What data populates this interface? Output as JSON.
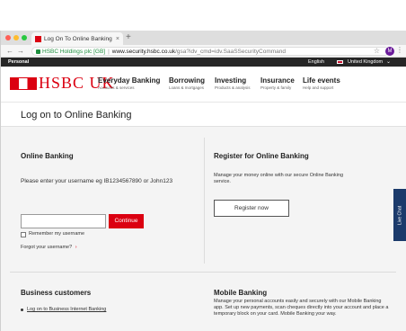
{
  "browser": {
    "tab_title": "Log On To Online Banking",
    "tab_close": "×",
    "new_tab": "+",
    "back": "←",
    "forward": "→",
    "secure_org": "HSBC Holdings plc [GB]",
    "url_host": "www.security.hsbc.co.uk",
    "url_path": "/gsa?idv_cmd=idv.SaaSSecurityCommand",
    "star": "☆",
    "profile_initial": "M",
    "menu": "⋮",
    "traffic_lights": [
      "#ff5f57",
      "#febc2e",
      "#28c840"
    ]
  },
  "topbar": {
    "personal": "Personal",
    "language": "English",
    "country": "United Kingdom"
  },
  "logo": {
    "text": "HSBC UK"
  },
  "nav": [
    {
      "title": "Everyday Banking",
      "subtitle": "Accounts & services"
    },
    {
      "title": "Borrowing",
      "subtitle": "Loans & mortgages"
    },
    {
      "title": "Investing",
      "subtitle": "Products & analysis"
    },
    {
      "title": "Insurance",
      "subtitle": "Property & family"
    },
    {
      "title": "Life events",
      "subtitle": "Help and support"
    }
  ],
  "page_title": "Log on to Online Banking",
  "online_banking": {
    "heading": "Online Banking",
    "instruction": "Please enter your username eg IB1234567890 or John123",
    "continue_label": "Continue",
    "remember_label": "Remember my username",
    "forgot_label": "Forgot your username?",
    "forgot_arrow": "›"
  },
  "register": {
    "heading": "Register for Online Banking",
    "text": "Manage your money online with our secure Online Banking service.",
    "button_label": "Register now"
  },
  "business": {
    "heading": "Business customers",
    "link": "Log on to Business Internet Banking"
  },
  "mobile": {
    "heading": "Mobile Banking",
    "text": "Manage your personal accounts easily and securely with our Mobile Banking app. Set up new payments, scan cheques directly into your account and place a temporary block on your card. Mobile Banking your way."
  },
  "chat": {
    "label": "Live Chat"
  },
  "colors": {
    "brand_red": "#db0011",
    "topbar_bg": "#262626",
    "chat_bg": "#1b3a6b"
  }
}
